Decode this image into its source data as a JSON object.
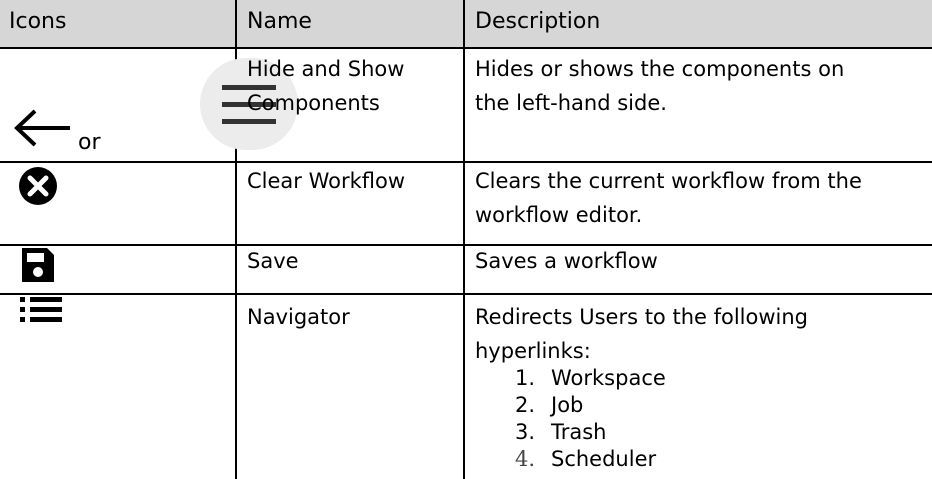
{
  "table": {
    "headers": [
      "Icons",
      "Name",
      "Description"
    ],
    "rows": [
      {
        "icon": "hide-show-icons",
        "or_text": "or",
        "name_lines": [
          "Hide and Show",
          "Components"
        ],
        "description_lines": [
          "Hides or shows the components on",
          "the left-hand side."
        ]
      },
      {
        "icon": "clear-circle-icon",
        "name_lines": [
          "Clear Workflow"
        ],
        "description_lines": [
          "Clears the current workflow from the",
          "workflow editor."
        ]
      },
      {
        "icon": "save-floppy-icon",
        "name_lines": [
          "Save"
        ],
        "description_lines": [
          "Saves a workflow"
        ]
      },
      {
        "icon": "list-icon",
        "name_lines": [
          "Navigator"
        ],
        "description_lines": [
          "Redirects Users to the following",
          "hyperlinks:"
        ],
        "list": [
          {
            "num": "1.",
            "label": "Workspace"
          },
          {
            "num": "2.",
            "label": "Job"
          },
          {
            "num": "3.",
            "label": "Trash"
          },
          {
            "num": "4.",
            "label": "Scheduler"
          }
        ]
      }
    ]
  },
  "colors": {
    "header_bg": "#d6d6d6",
    "border": "#000000",
    "menu_button_bg": "#ececec"
  }
}
